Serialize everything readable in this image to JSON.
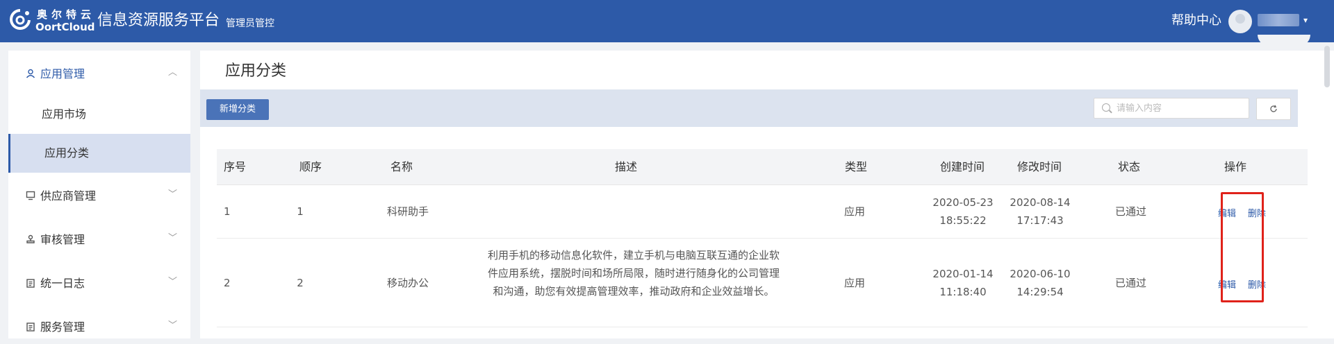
{
  "header": {
    "logo_cn": "奥尔特云",
    "logo_en": "OortCloud",
    "title": "信息资源服务平台",
    "subtitle": "管理员管控",
    "help": "帮助中心",
    "user_caret": "▾",
    "brand_color": "#2d5aa8"
  },
  "sidebar": {
    "groups": [
      {
        "label": "应用管理",
        "icon": "user-icon",
        "expanded": true
      },
      {
        "label": "供应商管理",
        "icon": "monitor-icon"
      },
      {
        "label": "审核管理",
        "icon": "stamp-icon"
      },
      {
        "label": "统一日志",
        "icon": "clipboard-icon"
      },
      {
        "label": "服务管理",
        "icon": "clipboard-icon"
      }
    ],
    "sub_items": [
      {
        "label": "应用市场"
      },
      {
        "label": "应用分类",
        "selected": true
      }
    ]
  },
  "main": {
    "title": "应用分类",
    "add_button": "新增分类",
    "search_placeholder": "请输入内容",
    "refresh_icon": "refresh-icon"
  },
  "table": {
    "columns": [
      "序号",
      "顺序",
      "名称",
      "描述",
      "类型",
      "创建时间",
      "修改时间",
      "状态",
      "操作"
    ],
    "rows": [
      {
        "index": "1",
        "order": "1",
        "name": "科研助手",
        "description": "",
        "type": "应用",
        "created_date": "2020-05-23",
        "created_time": "18:55:22",
        "modified_date": "2020-08-14",
        "modified_time": "17:17:43",
        "status": "已通过",
        "edit": "编辑",
        "delete": "删除"
      },
      {
        "index": "2",
        "order": "2",
        "name": "移动办公",
        "description": "利用手机的移动信息化软件，建立手机与电脑互联互通的企业软件应用系统，摆脱时间和场所局限，随时进行随身化的公司管理和沟通，助您有效提高管理效率，推动政府和企业效益增长。",
        "type": "应用",
        "created_date": "2020-01-14",
        "created_time": "11:18:40",
        "modified_date": "2020-06-10",
        "modified_time": "14:29:54",
        "status": "已通过",
        "edit": "编辑",
        "delete": "删除"
      }
    ]
  }
}
